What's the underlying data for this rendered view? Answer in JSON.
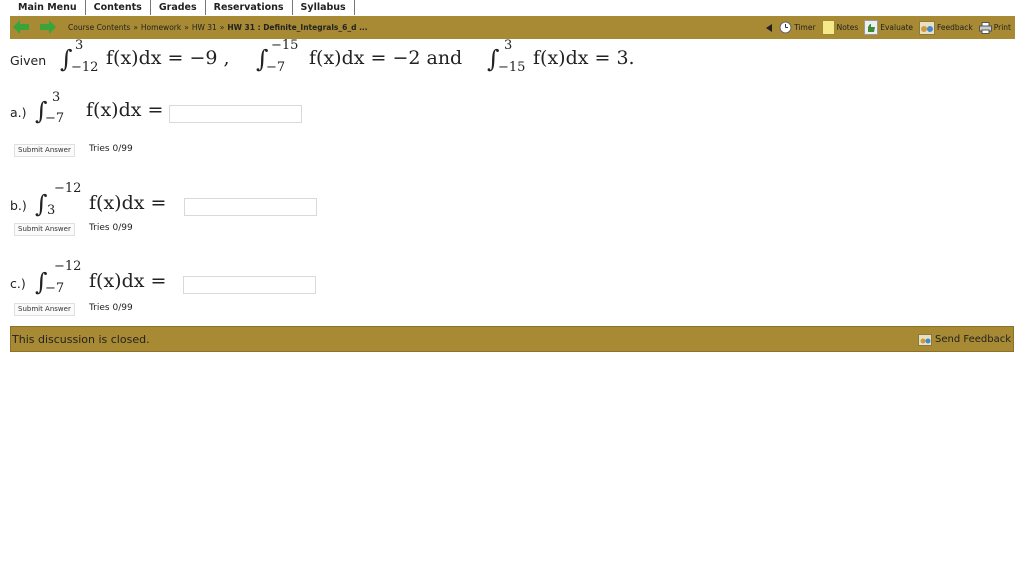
{
  "topmenu": {
    "tabs": [
      "Main Menu",
      "Contents",
      "Grades",
      "Reservations",
      "Syllabus"
    ]
  },
  "breadcrumb": {
    "items": [
      "Course Contents",
      "Homework",
      "HW 31"
    ],
    "current": "HW 31 : Definite_Integrals_6_d ...",
    "separator": "»"
  },
  "tools": {
    "timer": "Timer",
    "notes": "Notes",
    "evaluate": "Evaluate",
    "feedback": "Feedback",
    "print": "Print"
  },
  "problem": {
    "given_label": "Given",
    "given": {
      "i1_upper": "3",
      "i1_lower": "−12",
      "i1_rhs": "f(x)dx  =  −9 ,",
      "i2_upper": "−15",
      "i2_lower": "−7",
      "i2_rhs": "f(x)dx  =  −2 and",
      "i3_upper": "3",
      "i3_lower": "−15",
      "i3_rhs": "f(x)dx  =  3."
    },
    "parts": [
      {
        "label": "a.)",
        "upper": "3",
        "lower": "−7",
        "rhs": "f(x)dx  =",
        "submit": "Submit Answer",
        "tries": "Tries 0/99",
        "value": ""
      },
      {
        "label": "b.)",
        "upper": "−12",
        "lower": "3",
        "rhs": "f(x)dx  =",
        "submit": "Submit Answer",
        "tries": "Tries 0/99",
        "value": ""
      },
      {
        "label": "c.)",
        "upper": "−12",
        "lower": "−7",
        "rhs": "f(x)dx  =",
        "submit": "Submit Answer",
        "tries": "Tries 0/99",
        "value": ""
      }
    ]
  },
  "discussion": {
    "status": "This discussion is closed.",
    "send_feedback": "Send Feedback"
  },
  "colors": {
    "bar": "#a78a33",
    "arrow": "#3aa33a"
  }
}
